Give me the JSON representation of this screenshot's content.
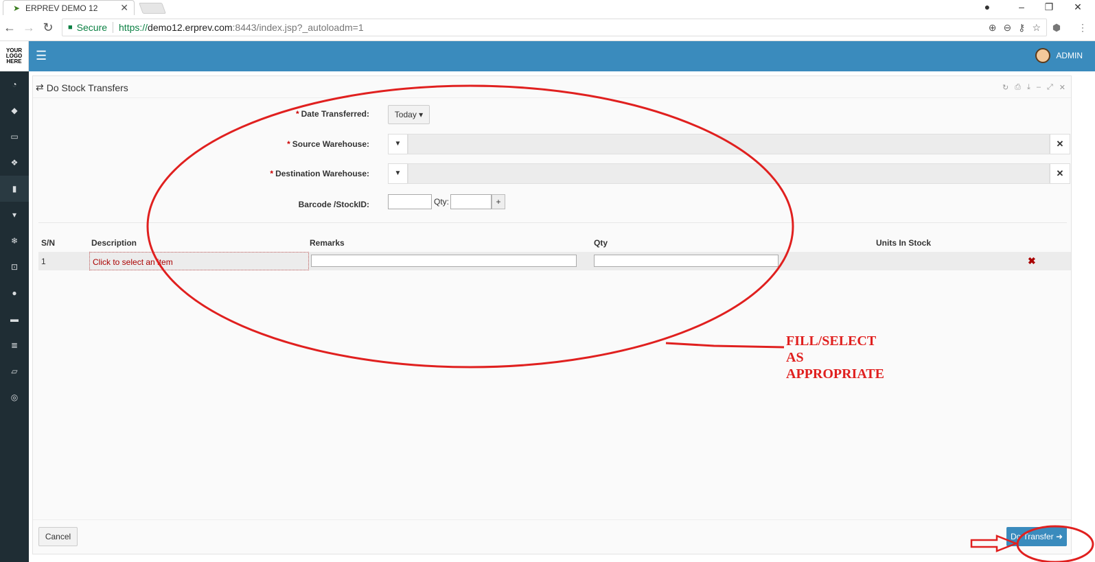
{
  "browser": {
    "tab_title": "ERPREV DEMO 12",
    "secure_label": "Secure",
    "url_scheme": "https://",
    "url_host": "demo12.erprev.com",
    "url_rest": ":8443/index.jsp?_autoloadm=1"
  },
  "app": {
    "logo_lines": [
      "YOUR",
      "LOGO",
      "HERE"
    ],
    "user_name": "ADMIN",
    "sidebar_icons": [
      "dashboard-icon",
      "tag-icon",
      "money-icon",
      "cubes-icon",
      "building-icon",
      "trash-icon",
      "snowflake-icon",
      "cart-icon",
      "disc-icon",
      "desktop-icon",
      "database-icon",
      "book-icon",
      "lifebuoy-icon"
    ]
  },
  "panel": {
    "title": "Do Stock Transfers",
    "form": {
      "date_label": "Date Transferred:",
      "date_value": "Today",
      "source_label": "Source Warehouse:",
      "destination_label": "Destination Warehouse:",
      "barcode_label": "Barcode /StockID:",
      "qty_label": "Qty:",
      "plus_label": "+",
      "required_mark": "*"
    },
    "table": {
      "headers": [
        "S/N",
        "Description",
        "Remarks",
        "Qty",
        "Units In Stock"
      ],
      "rows": [
        {
          "sn": "1",
          "description": "Click to select an item",
          "remarks": "",
          "qty": "",
          "units_in_stock": ""
        }
      ]
    },
    "cancel_label": "Cancel",
    "transfer_label": "Do Transfer"
  },
  "annotation": {
    "lines": [
      "FILL/SELECT",
      "AS",
      "APPROPRIATE"
    ],
    "color": "#e0201f"
  }
}
